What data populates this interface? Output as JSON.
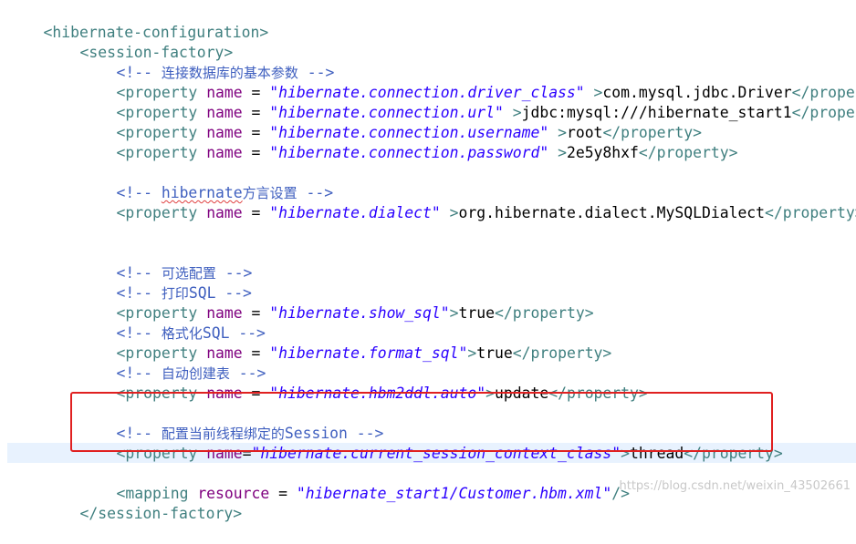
{
  "editor": {
    "lines": {
      "l0": {
        "open": "<",
        "tag": "hibernate-configuration",
        "close": ">"
      },
      "l1": {
        "open": "<",
        "tag": "session-factory",
        "close": ">"
      },
      "l2": {
        "start": "<!-- ",
        "text": "连接数据库的基本参数",
        "end": " -->"
      },
      "l3": {
        "open": "<",
        "tag": "property",
        "sp1": " ",
        "attr": "name",
        "eq": " = ",
        "val": "\"hibernate.connection.driver_class\"",
        "sp2": " ",
        "gt": ">",
        "content": "com.mysql.jdbc.Driver",
        "endtag": "</property"
      },
      "l4": {
        "open": "<",
        "tag": "property",
        "sp1": " ",
        "attr": "name",
        "eq": " = ",
        "val": "\"hibernate.connection.url\"",
        "sp2": " ",
        "gt": ">",
        "content": "jdbc:mysql:///hibernate_start1",
        "endtag": "</property"
      },
      "l5": {
        "open": "<",
        "tag": "property",
        "sp1": " ",
        "attr": "name",
        "eq": " = ",
        "val": "\"hibernate.connection.username\"",
        "sp2": " ",
        "gt": ">",
        "content": "root",
        "endtag": "</property>"
      },
      "l6": {
        "open": "<",
        "tag": "property",
        "sp1": " ",
        "attr": "name",
        "eq": " = ",
        "val": "\"hibernate.connection.password\"",
        "sp2": " ",
        "gt": ">",
        "content": "2e5y8hxf",
        "endtag": "</property>"
      },
      "l8": {
        "start": "<!-- ",
        "word": "hibernate",
        "text": "方言设置",
        "end": " -->"
      },
      "l9": {
        "open": "<",
        "tag": "property",
        "sp1": " ",
        "attr": "name",
        "eq": " = ",
        "val": "\"hibernate.dialect\"",
        "sp2": " ",
        "gt": ">",
        "content": "org.hibernate.dialect.MySQLDialect",
        "endtag": "</property>"
      },
      "l12": {
        "start": "<!-- ",
        "text": "可选配置",
        "end": " -->"
      },
      "l13": {
        "start": "<!-- ",
        "text": "打印",
        "ascii": "SQL",
        "end": " -->"
      },
      "l14": {
        "open": "<",
        "tag": "property",
        "sp1": " ",
        "attr": "name",
        "eq": " = ",
        "val": "\"hibernate.show_sql\"",
        "gt": ">",
        "content": "true",
        "endtag": "</property>"
      },
      "l15": {
        "start": "<!-- ",
        "text": "格式化",
        "ascii": "SQL",
        "end": " -->"
      },
      "l16": {
        "open": "<",
        "tag": "property",
        "sp1": " ",
        "attr": "name",
        "eq": " = ",
        "val": "\"hibernate.format_sql\"",
        "gt": ">",
        "content": "true",
        "endtag": "</property>"
      },
      "l17": {
        "start": "<!-- ",
        "text": "自动创建表",
        "end": " -->"
      },
      "l18": {
        "open": "<",
        "tag": "property",
        "sp1": " ",
        "attr": "name",
        "eq": " = ",
        "val": "\"hibernate.hbm2ddl.auto\"",
        "gt": ">",
        "content": "update",
        "endtag": "</property>"
      },
      "l20": {
        "start": "<!-- ",
        "text": "配置当前线程绑定的",
        "ascii": "Session",
        "end": " -->"
      },
      "l21": {
        "open": "<",
        "tag": "property",
        "sp1": " ",
        "attr": "name",
        "eq": "=",
        "val": "\"hibernate.current_session_context_class\"",
        "gt": ">",
        "content": "thread",
        "endtag": "</property>"
      },
      "l23": {
        "open": "<",
        "tag": "mapping",
        "sp1": " ",
        "attr": "resource",
        "eq": " = ",
        "val": "\"hibernate_start1/Customer.hbm.xml\"",
        "end": "/>"
      },
      "l24": {
        "endtag": "</session-factory>"
      }
    }
  },
  "watermark": "https://blog.csdn.net/weixin_43502661",
  "colors": {
    "tag": "#3f7f7f",
    "attribute": "#7f007f",
    "string": "#2a00ff",
    "comment": "#3f5fbf",
    "highlight_box": "#e02020",
    "current_line": "#e8f2fe"
  }
}
